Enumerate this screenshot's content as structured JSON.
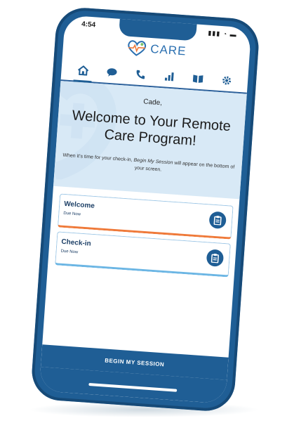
{
  "status": {
    "time": "4:54",
    "icons": "▮▮▮ ◔ ▬"
  },
  "brand": {
    "name": "CARE"
  },
  "nav": {
    "items": [
      {
        "name": "home",
        "icon": "home-icon"
      },
      {
        "name": "messages",
        "icon": "chat-icon"
      },
      {
        "name": "calls",
        "icon": "phone-icon"
      },
      {
        "name": "stats",
        "icon": "bar-chart-icon"
      },
      {
        "name": "library",
        "icon": "book-icon"
      },
      {
        "name": "settings",
        "icon": "gear-icon"
      }
    ],
    "active": "home"
  },
  "hero": {
    "greeting": "Cade,",
    "title": "Welcome to Your Remote Care Program!",
    "note_prefix": "When it's time for your check-in,",
    "note_emphasis": "Begin My Session",
    "note_suffix": "will appear on the bottom of your screen."
  },
  "cards": [
    {
      "title": "Welcome",
      "status": "Due Now",
      "accent": "#ef7a3a"
    },
    {
      "title": "Check-in",
      "status": "Due Now",
      "accent": "#6cb6e4"
    }
  ],
  "begin_button": {
    "label": "BEGIN MY SESSION"
  },
  "colors": {
    "primary": "#1f5e95",
    "hero_bg": "#d8e9f6"
  }
}
